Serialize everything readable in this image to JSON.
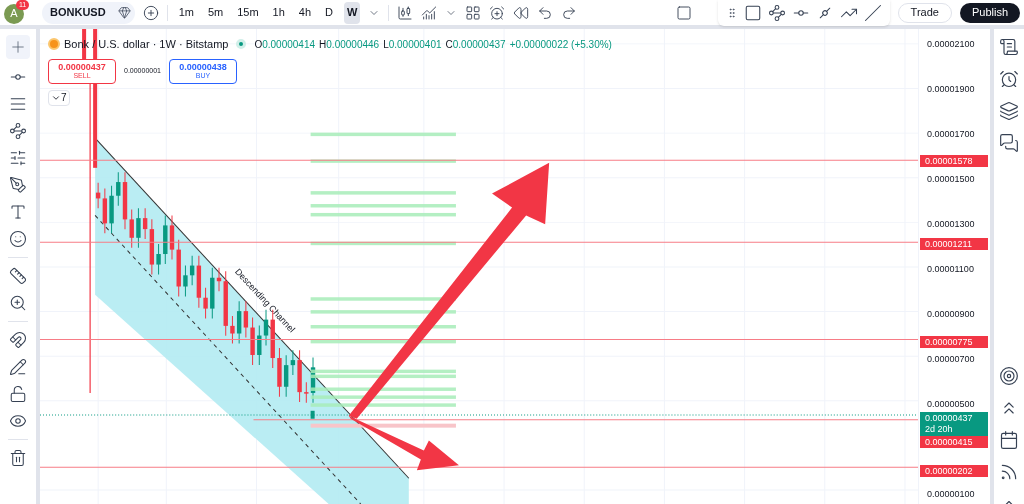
{
  "top_bar": {
    "avatar": {
      "initial": "A",
      "badge": "11"
    },
    "symbol": "BONKUSD",
    "intervals": [
      {
        "label": "1m",
        "selected": false
      },
      {
        "label": "5m",
        "selected": false
      },
      {
        "label": "15m",
        "selected": false
      },
      {
        "label": "1h",
        "selected": false
      },
      {
        "label": "4h",
        "selected": false
      },
      {
        "label": "D",
        "selected": false
      },
      {
        "label": "W",
        "selected": true
      }
    ],
    "buttons": [
      {
        "label": "Trade",
        "kind": "outline"
      },
      {
        "label": "Publish",
        "kind": "dark"
      }
    ]
  },
  "legend": {
    "title": "Bonk / U.S. dollar · 1W · Bitstamp",
    "ohlc": [
      {
        "key": "O",
        "value": "0.00000414"
      },
      {
        "key": "H",
        "value": "0.00000446"
      },
      {
        "key": "L",
        "value": "0.00000401"
      },
      {
        "key": "C",
        "value": "0.00000437"
      }
    ],
    "change": "+0.00000022 (+5.30%)",
    "sell": {
      "price": "0.00000437",
      "label": "SELL"
    },
    "spread": "0.00000001",
    "buy": {
      "price": "0.00000438",
      "label": "BUY"
    },
    "indicators_count": "7"
  },
  "chart": {
    "annotation": "Descending Channel"
  },
  "price_axis": {
    "ticks": [
      "0.00002100",
      "0.00001900",
      "0.00001700",
      "0.00001500",
      "0.00001300",
      "0.00001100",
      "0.00000900",
      "0.00000700",
      "0.00000500",
      "0.00000100"
    ],
    "tags": [
      {
        "value": "0.00001578",
        "kind": "level"
      },
      {
        "value": "0.00001211",
        "kind": "level"
      },
      {
        "value": "0.00000775",
        "kind": "level"
      },
      {
        "value": "0.00000437",
        "kind": "last",
        "countdown": "2d 20h"
      },
      {
        "value": "0.00000415",
        "kind": "level"
      },
      {
        "value": "0.00000202",
        "kind": "level"
      }
    ]
  }
}
